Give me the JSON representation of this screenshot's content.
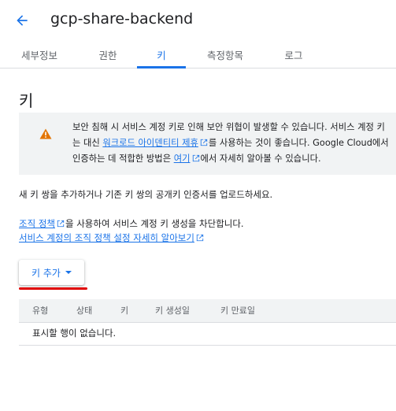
{
  "header": {
    "title": "gcp-share-backend"
  },
  "tabs": [
    {
      "label": "세부정보",
      "active": false
    },
    {
      "label": "권한",
      "active": false
    },
    {
      "label": "키",
      "active": true
    },
    {
      "label": "측정항목",
      "active": false
    },
    {
      "label": "로그",
      "active": false
    }
  ],
  "section": {
    "title": "키"
  },
  "warning": {
    "line1": "보안 침해 시 서비스 계정 키로 인해 보안 위협이 발생할 수 있습니다. 서비스 계정 키",
    "line2_before": "는 대신 ",
    "line2_link": "워크로드 아이덴티티 제휴",
    "line2_after": "를 사용하는 것이 좋습니다. Google Cloud에서",
    "line3_before": "인증하는 데 적합한 방법은 ",
    "line3_link": "여기",
    "line3_after": "에서 자세히 알아볼 수 있습니다."
  },
  "description": "새 키 쌍을 추가하거나 기존 키 쌍의 공개키 인증서를 업로드하세요.",
  "policy": {
    "link1": "조직 정책",
    "text1": "을 사용하여 서비스 계정 키 생성을 차단합니다.",
    "link2": "서비스 계정의 조직 정책 설정 자세히 알아보기"
  },
  "add_key": {
    "label": "키 추가"
  },
  "table": {
    "columns": [
      "유형",
      "상태",
      "키",
      "키 생성일",
      "키 만료일"
    ],
    "empty_message": "표시할 행이 없습니다."
  },
  "colors": {
    "accent": "#1a73e8",
    "warning_icon": "#e37400",
    "highlight_underline": "#e00000"
  }
}
